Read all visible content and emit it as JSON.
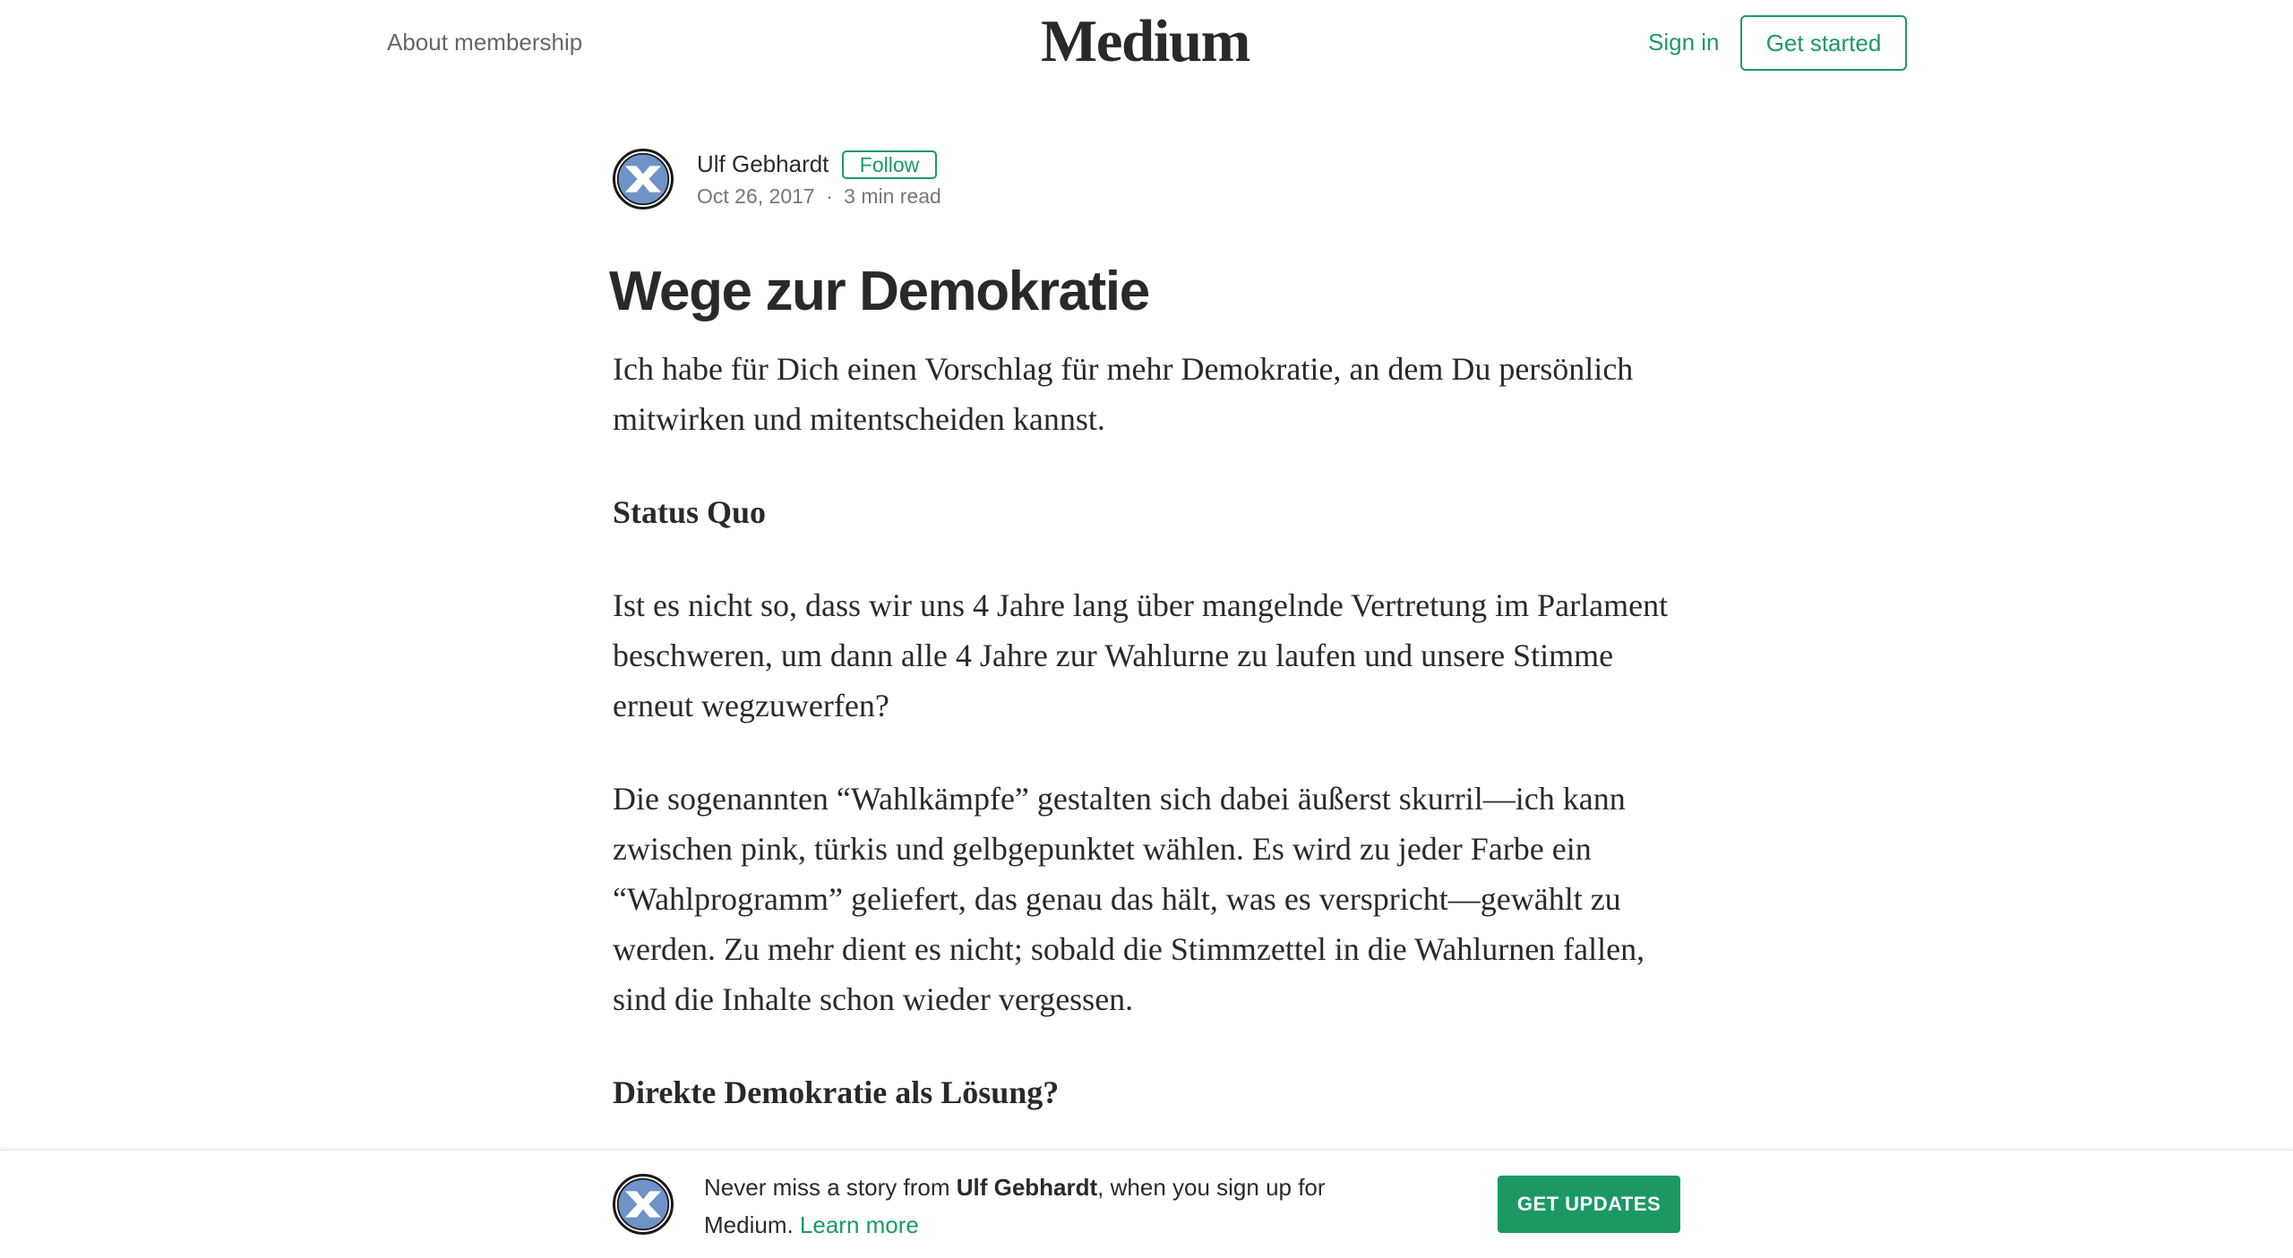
{
  "header": {
    "about_label": "About membership",
    "logo_text": "Medium",
    "signin_label": "Sign in",
    "get_started_label": "Get started"
  },
  "author": {
    "name": "Ulf Gebhardt",
    "follow_label": "Follow",
    "date": "Oct 26, 2017",
    "separator": "·",
    "read_time": "3 min read"
  },
  "article": {
    "title": "Wege zur Demokratie",
    "intro": "Ich habe für Dich einen Vorschlag für mehr Demokratie, an dem Du persönlich mitwirken und mitentscheiden kannst.",
    "heading_1": "Status Quo",
    "paragraph_1": "Ist es nicht so, dass wir uns 4 Jahre lang über mangelnde Vertretung im Parlament beschweren, um dann alle 4 Jahre zur Wahlurne zu laufen und unsere Stimme erneut wegzuwerfen?",
    "paragraph_2": "Die sogenannten “Wahlkämpfe” gestalten sich dabei äußerst skurril—ich kann zwischen pink, türkis und gelbgepunktet wählen. Es wird zu jeder Farbe ein “Wahlprogramm” geliefert, das genau das hält, was es verspricht—gewählt zu werden. Zu mehr dient es nicht; sobald die Stimmzettel in die Wahlurnen fallen, sind die Inhalte schon wieder vergessen.",
    "heading_2": "Direkte Demokratie als Lösung?"
  },
  "footer_cta": {
    "text_before": "Never miss a story from ",
    "author_name": "Ulf Gebhardt",
    "text_after": ", when you sign up for Medium. ",
    "learn_more_label": "Learn more",
    "button_label": "GET UPDATES"
  },
  "colors": {
    "accent": "#1c9963",
    "text": "#292929",
    "muted": "#757575"
  },
  "icons": {
    "avatar": "avatar-cross-icon"
  }
}
